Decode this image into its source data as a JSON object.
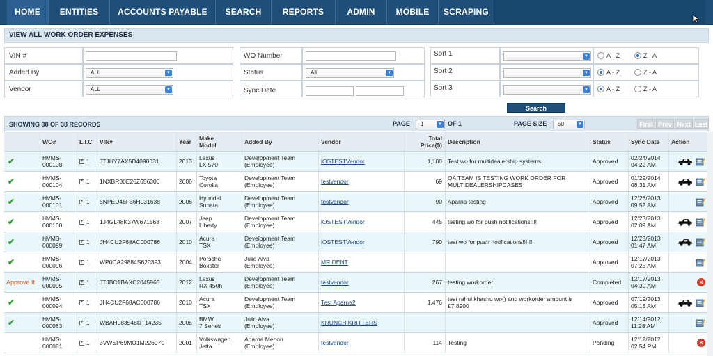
{
  "nav": {
    "items": [
      {
        "label": "HOME"
      },
      {
        "label": "ENTITIES"
      },
      {
        "label": "ACCOUNTS PAYABLE"
      },
      {
        "label": "SEARCH"
      },
      {
        "label": "REPORTS"
      },
      {
        "label": "ADMIN"
      },
      {
        "label": "MOBILE"
      },
      {
        "label": "SCRAPING"
      }
    ]
  },
  "page": {
    "title": "VIEW ALL WORK ORDER EXPENSES"
  },
  "filters": {
    "vin_label": "VIN #",
    "vin_value": "",
    "added_by_label": "Added By",
    "added_by_value": "ALL",
    "vendor_label": "Vendor",
    "vendor_value": "ALL",
    "wo_number_label": "WO Number",
    "wo_number_value": "",
    "status_label": "Status",
    "status_value": "All",
    "sync_date_label": "Sync Date",
    "sync_date_from": "",
    "sync_date_to": "",
    "sort1_label": "Sort 1",
    "sort2_label": "Sort 2",
    "sort3_label": "Sort 3",
    "sort_value": "",
    "az_label": "A - Z",
    "za_label": "Z - A",
    "sort1_selected": "za",
    "sort2_selected": "az",
    "sort3_selected": "az"
  },
  "search_button": "Search",
  "pager": {
    "records_text": "SHOWING 38 OF 38 RECORDS",
    "page_label": "PAGE",
    "page_value": "1",
    "of_text": "OF 1",
    "page_size_label": "PAGE SIZE",
    "page_size_value": "50",
    "first": "First",
    "prev": "Prev",
    "next": "Next",
    "last": "Last"
  },
  "table": {
    "headers": {
      "wo": "WO#",
      "lic": "L.I.C",
      "vin": "VIN#",
      "year": "Year",
      "make_model": "Make\nModel",
      "added_by": "Added By",
      "vendor": "Vendor",
      "total": "Total\nPrice($)",
      "description": "Description",
      "status": "Status",
      "sync_date": "Sync Date",
      "action": "Action"
    },
    "rows": [
      {
        "flag": "check",
        "wo": "HVMS-\n000108",
        "lic": "1",
        "vin": "JTJHY7AX5D4090631",
        "year": "2013",
        "make": "Lexus\nLX 570",
        "added_by": "Development Team\n(Employee)",
        "vendor": "iOSTESTVendor",
        "total": "1,100",
        "description": "Test wo for multidealership systems",
        "status": "Approved",
        "sync": "02/24/2014\n04:22 AM",
        "car": true,
        "edit": true,
        "del": false
      },
      {
        "flag": "check",
        "wo": "HVMS-\n000104",
        "lic": "1",
        "vin": "1NXBR30E26Z656306",
        "year": "2006",
        "make": "Toyota\nCorolla",
        "added_by": "Development Team\n(Employee)",
        "vendor": "testvendor",
        "total": "69",
        "description": "QA TEAM IS TESTING WORK ORDER FOR\nMULTIDEALERSHIPCASES",
        "status": "Approved",
        "sync": "01/29/2014\n08:31 AM",
        "car": true,
        "edit": true,
        "del": false
      },
      {
        "flag": "check",
        "wo": "HVMS-\n000101",
        "lic": "1",
        "vin": "5NPEU46F36H031638",
        "year": "2006",
        "make": "Hyundai\nSonata",
        "added_by": "Development Team\n(Employee)",
        "vendor": "testvendor",
        "total": "90",
        "description": "Aparna testing",
        "status": "Approved",
        "sync": "12/23/2013\n09:52 AM",
        "car": false,
        "edit": true,
        "del": false
      },
      {
        "flag": "check",
        "wo": "HVMS-\n000100",
        "lic": "1",
        "vin": "1J4GL48K37W671568",
        "year": "2007",
        "make": "Jeep\nLiberty",
        "added_by": "Development Team\n(Employee)",
        "vendor": "iOSTESTVendor",
        "total": "445",
        "description": "testing wo for push notifications!!!!",
        "status": "Approved",
        "sync": "12/23/2013\n02:09 AM",
        "car": true,
        "edit": true,
        "del": false
      },
      {
        "flag": "check",
        "wo": "HVMS-\n000099",
        "lic": "1",
        "vin": "JH4CU2F68AC000786",
        "year": "2010",
        "make": "Acura\nTSX",
        "added_by": "Development Team\n(Employee)",
        "vendor": "iOSTESTVendor",
        "total": "790",
        "description": "test wo for push notifications!!!!!!!",
        "status": "Approved",
        "sync": "12/23/2013\n01:47 AM",
        "car": true,
        "edit": true,
        "del": false
      },
      {
        "flag": "check",
        "wo": "HVMS-\n000096",
        "lic": "1",
        "vin": "WP0CA29884S620393",
        "year": "2004",
        "make": "Porsche\nBoxster",
        "added_by": "Julio Alva\n(Employee)",
        "vendor": "MR DENT",
        "total": "",
        "description": "",
        "status": "Approved",
        "sync": "12/17/2013\n07:25 AM",
        "car": false,
        "edit": true,
        "del": false
      },
      {
        "flag": "approve",
        "wo": "HVMS-\n000095",
        "lic": "1",
        "vin": "JTJBC1BAXC2045965",
        "year": "2012",
        "make": "Lexus\nRX 450h",
        "added_by": "Development Team\n(Employee)",
        "vendor": "testvendor",
        "total": "267",
        "description": "testing workorder",
        "status": "Completed",
        "sync": "12/17/2013\n04:30 AM",
        "car": false,
        "edit": false,
        "del": true
      },
      {
        "flag": "check",
        "wo": "HVMS-\n000094",
        "lic": "1",
        "vin": "JH4CU2F68AC000786",
        "year": "2010",
        "make": "Acura\nTSX",
        "added_by": "Development Team\n(Employee)",
        "vendor": "Test Aparna2",
        "total": "1,476",
        "description": "test rahul khashu wo() and workorder amount is\n£7,8900",
        "status": "Approved",
        "sync": "07/19/2013\n05:13 AM",
        "car": true,
        "edit": true,
        "del": false
      },
      {
        "flag": "check",
        "wo": "HVMS-\n000083",
        "lic": "1",
        "vin": "WBAHL83548DT14235",
        "year": "2008",
        "make": "BMW\n7 Series",
        "added_by": "Julio Alva\n(Employee)",
        "vendor": "KRUNCH KRITTERS",
        "total": "",
        "description": "",
        "status": "Approved",
        "sync": "12/14/2012\n11:28 AM",
        "car": false,
        "edit": true,
        "del": false
      },
      {
        "flag": "",
        "wo": "HVMS-\n000081",
        "lic": "1",
        "vin": "3VWSP69MO1M226970",
        "year": "2001",
        "make": "Volkswagen\nJetta",
        "added_by": "Aparna Menon\n(Employee)",
        "vendor": "testvendor",
        "total": "114",
        "description": "Testing",
        "status": "Pending",
        "sync": "12/12/2012\n02:54 PM",
        "car": false,
        "edit": false,
        "del": true
      }
    ]
  },
  "labels": {
    "approve_it": "Approve It"
  },
  "colors": {
    "nav": "#1f4e78",
    "row_alt": "#e9f7fb",
    "check": "#2f9c2f",
    "approve": "#d45a1a",
    "delete": "#d43a2a"
  }
}
